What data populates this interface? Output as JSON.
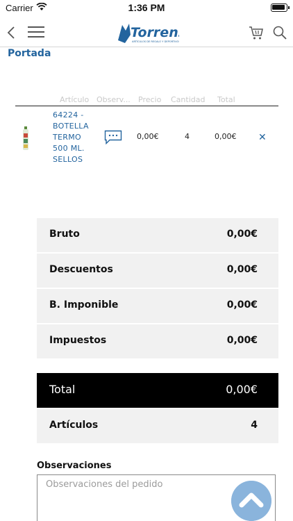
{
  "status_bar": {
    "carrier": "Carrier",
    "time": "1:36 PM"
  },
  "nav": {
    "logo_text": "Torrens",
    "logo_tagline": "ARTÍCULOS DE REGALO Y DEPORTIVOS"
  },
  "breadcrumb": "Portada",
  "table": {
    "headers": {
      "article": "Artículo",
      "notes": "Observ...",
      "price": "Precio",
      "quantity": "Cantidad",
      "total": "Total"
    },
    "rows": [
      {
        "description": "64224 - BOTELLA TERMO 500 ML. SELLOS",
        "price": "0,00€",
        "quantity": "4",
        "total": "0,00€"
      }
    ]
  },
  "summary": {
    "gross_label": "Bruto",
    "gross_value": "0,00€",
    "discounts_label": "Descuentos",
    "discounts_value": "0,00€",
    "taxable_label": "B. Imponible",
    "taxable_value": "0,00€",
    "taxes_label": "Impuestos",
    "taxes_value": "0,00€",
    "total_label": "Total",
    "total_value": "0,00€",
    "items_label": "Artículos",
    "items_value": "4"
  },
  "observations": {
    "title": "Observaciones",
    "placeholder": "Observaciones del pedido"
  },
  "colors": {
    "accent": "#23649e",
    "total_bg": "#000000",
    "summary_bg": "#f1f1f1",
    "scroll_button": "#8ab4dc"
  },
  "icons": {
    "back": "chevron-left-icon",
    "menu": "hamburger-icon",
    "cart": "cart-icon",
    "search": "search-icon",
    "note": "chat-bubble-icon",
    "remove": "close-icon",
    "scroll_top": "chevron-up-icon"
  }
}
